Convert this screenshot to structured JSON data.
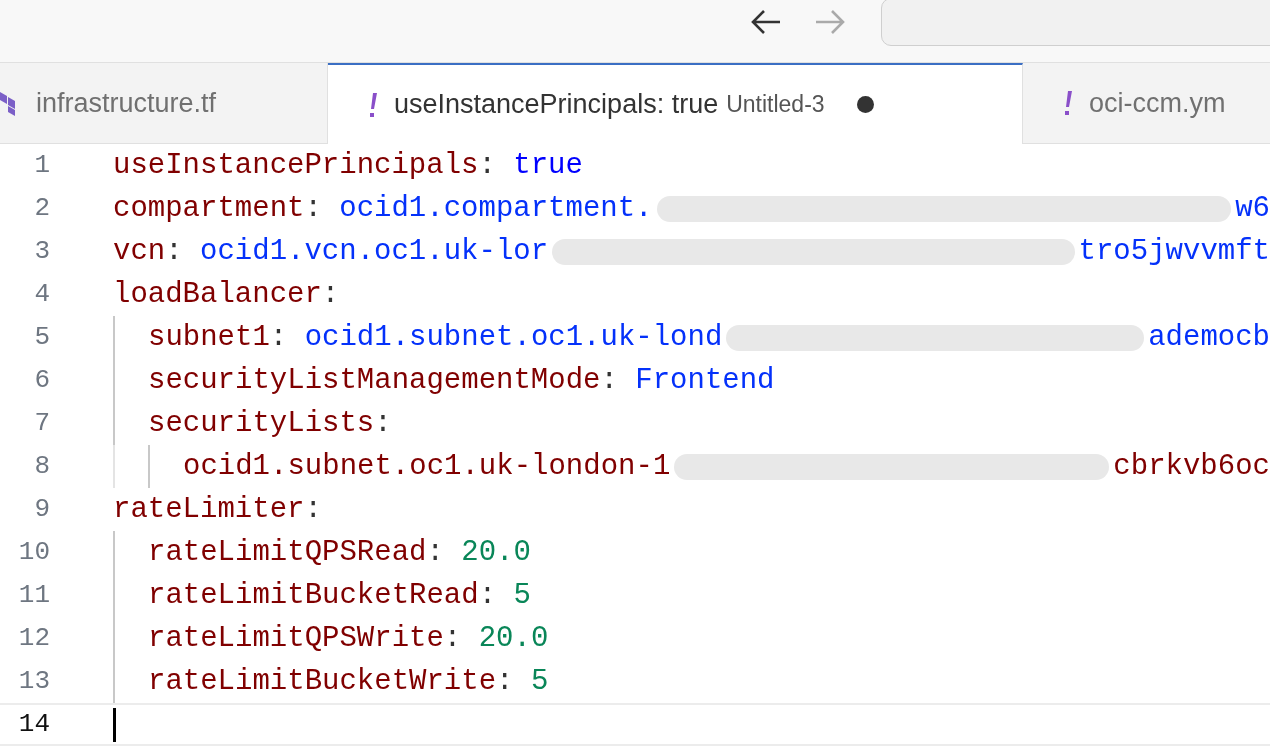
{
  "tabs": [
    {
      "kind": "terraform",
      "label": "infrastructure.tf",
      "selected": false
    },
    {
      "kind": "yaml",
      "label": "useInstancePrincipals: true",
      "description": "Untitled-3",
      "dirty": true,
      "selected": true
    },
    {
      "kind": "yaml",
      "label": "oci-ccm.ym",
      "selected": false
    }
  ],
  "editor": {
    "lines": [
      {
        "number": "1",
        "cursor": false,
        "tokens": [
          {
            "kind": "key",
            "text": "useInstancePrincipals"
          },
          {
            "kind": "punct",
            "text": ": "
          },
          {
            "kind": "bool",
            "text": "true"
          }
        ]
      },
      {
        "number": "2",
        "cursor": false,
        "tokens": [
          {
            "kind": "key",
            "text": "compartment"
          },
          {
            "kind": "punct",
            "text": ": "
          },
          {
            "kind": "string",
            "text": "ocid1.compartment."
          },
          {
            "kind": "redaction"
          },
          {
            "kind": "string",
            "text": "w6"
          }
        ]
      },
      {
        "number": "3",
        "cursor": false,
        "tokens": [
          {
            "kind": "key",
            "text": "vcn"
          },
          {
            "kind": "punct",
            "text": ": "
          },
          {
            "kind": "string",
            "text": "ocid1.vcn.oc1.uk-lor"
          },
          {
            "kind": "redaction"
          },
          {
            "kind": "string",
            "text": "tro5jwvvmft"
          }
        ]
      },
      {
        "number": "4",
        "cursor": false,
        "tokens": [
          {
            "kind": "key",
            "text": "loadBalancer"
          },
          {
            "kind": "punct",
            "text": ":"
          }
        ],
        "children": [
          {
            "number": "5",
            "cursor": false,
            "tokens": [
              {
                "kind": "key",
                "text": "subnet1"
              },
              {
                "kind": "punct",
                "text": ": "
              },
              {
                "kind": "string",
                "text": "ocid1.subnet.oc1.uk-lond"
              },
              {
                "kind": "redaction"
              },
              {
                "kind": "string",
                "text": "ademocb"
              }
            ]
          },
          {
            "number": "6",
            "cursor": false,
            "tokens": [
              {
                "kind": "key",
                "text": "securityListManagementMode"
              },
              {
                "kind": "punct",
                "text": ": "
              },
              {
                "kind": "string",
                "text": "Frontend"
              }
            ]
          },
          {
            "number": "7",
            "cursor": false,
            "tokens": [
              {
                "kind": "key",
                "text": "securityLists"
              },
              {
                "kind": "punct",
                "text": ":"
              }
            ],
            "children": [
              {
                "number": "8",
                "cursor": false,
                "tokens": [
                  {
                    "kind": "plain",
                    "text": "ocid1.subnet.oc1.uk-london-1"
                  },
                  {
                    "kind": "redaction"
                  },
                  {
                    "kind": "plain",
                    "text": "cbrkvb6oc"
                  }
                ]
              }
            ]
          }
        ]
      },
      {
        "number": "9",
        "cursor": false,
        "tokens": [
          {
            "kind": "key",
            "text": "rateLimiter"
          },
          {
            "kind": "punct",
            "text": ":"
          }
        ],
        "children": [
          {
            "number": "10",
            "cursor": false,
            "tokens": [
              {
                "kind": "key",
                "text": "rateLimitQPSRead"
              },
              {
                "kind": "punct",
                "text": ": "
              },
              {
                "kind": "number",
                "text": "20.0"
              }
            ]
          },
          {
            "number": "11",
            "cursor": false,
            "tokens": [
              {
                "kind": "key",
                "text": "rateLimitBucketRead"
              },
              {
                "kind": "punct",
                "text": ": "
              },
              {
                "kind": "number",
                "text": "5"
              }
            ]
          },
          {
            "number": "12",
            "cursor": false,
            "tokens": [
              {
                "kind": "key",
                "text": "rateLimitQPSWrite"
              },
              {
                "kind": "punct",
                "text": ": "
              },
              {
                "kind": "number",
                "text": "20.0"
              }
            ]
          },
          {
            "number": "13",
            "cursor": false,
            "tokens": [
              {
                "kind": "key",
                "text": "rateLimitBucketWrite"
              },
              {
                "kind": "punct",
                "text": ": "
              },
              {
                "kind": "number",
                "text": "5"
              }
            ]
          }
        ]
      },
      {
        "number": "14",
        "cursor": true
      }
    ]
  }
}
